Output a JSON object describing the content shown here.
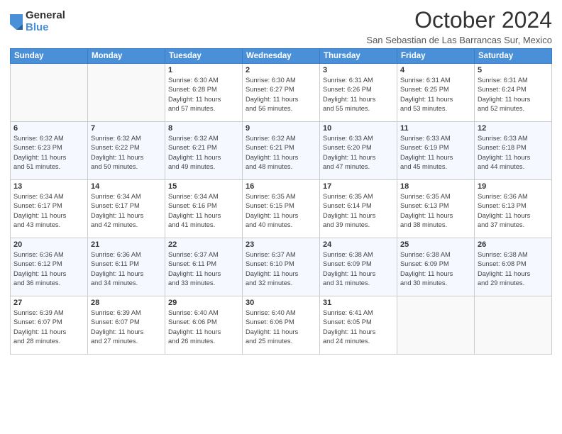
{
  "logo": {
    "general": "General",
    "blue": "Blue"
  },
  "title": "October 2024",
  "location": "San Sebastian de Las Barrancas Sur, Mexico",
  "weekdays": [
    "Sunday",
    "Monday",
    "Tuesday",
    "Wednesday",
    "Thursday",
    "Friday",
    "Saturday"
  ],
  "weeks": [
    [
      {
        "day": "",
        "info": ""
      },
      {
        "day": "",
        "info": ""
      },
      {
        "day": "1",
        "info": "Sunrise: 6:30 AM\nSunset: 6:28 PM\nDaylight: 11 hours\nand 57 minutes."
      },
      {
        "day": "2",
        "info": "Sunrise: 6:30 AM\nSunset: 6:27 PM\nDaylight: 11 hours\nand 56 minutes."
      },
      {
        "day": "3",
        "info": "Sunrise: 6:31 AM\nSunset: 6:26 PM\nDaylight: 11 hours\nand 55 minutes."
      },
      {
        "day": "4",
        "info": "Sunrise: 6:31 AM\nSunset: 6:25 PM\nDaylight: 11 hours\nand 53 minutes."
      },
      {
        "day": "5",
        "info": "Sunrise: 6:31 AM\nSunset: 6:24 PM\nDaylight: 11 hours\nand 52 minutes."
      }
    ],
    [
      {
        "day": "6",
        "info": "Sunrise: 6:32 AM\nSunset: 6:23 PM\nDaylight: 11 hours\nand 51 minutes."
      },
      {
        "day": "7",
        "info": "Sunrise: 6:32 AM\nSunset: 6:22 PM\nDaylight: 11 hours\nand 50 minutes."
      },
      {
        "day": "8",
        "info": "Sunrise: 6:32 AM\nSunset: 6:21 PM\nDaylight: 11 hours\nand 49 minutes."
      },
      {
        "day": "9",
        "info": "Sunrise: 6:32 AM\nSunset: 6:21 PM\nDaylight: 11 hours\nand 48 minutes."
      },
      {
        "day": "10",
        "info": "Sunrise: 6:33 AM\nSunset: 6:20 PM\nDaylight: 11 hours\nand 47 minutes."
      },
      {
        "day": "11",
        "info": "Sunrise: 6:33 AM\nSunset: 6:19 PM\nDaylight: 11 hours\nand 45 minutes."
      },
      {
        "day": "12",
        "info": "Sunrise: 6:33 AM\nSunset: 6:18 PM\nDaylight: 11 hours\nand 44 minutes."
      }
    ],
    [
      {
        "day": "13",
        "info": "Sunrise: 6:34 AM\nSunset: 6:17 PM\nDaylight: 11 hours\nand 43 minutes."
      },
      {
        "day": "14",
        "info": "Sunrise: 6:34 AM\nSunset: 6:17 PM\nDaylight: 11 hours\nand 42 minutes."
      },
      {
        "day": "15",
        "info": "Sunrise: 6:34 AM\nSunset: 6:16 PM\nDaylight: 11 hours\nand 41 minutes."
      },
      {
        "day": "16",
        "info": "Sunrise: 6:35 AM\nSunset: 6:15 PM\nDaylight: 11 hours\nand 40 minutes."
      },
      {
        "day": "17",
        "info": "Sunrise: 6:35 AM\nSunset: 6:14 PM\nDaylight: 11 hours\nand 39 minutes."
      },
      {
        "day": "18",
        "info": "Sunrise: 6:35 AM\nSunset: 6:13 PM\nDaylight: 11 hours\nand 38 minutes."
      },
      {
        "day": "19",
        "info": "Sunrise: 6:36 AM\nSunset: 6:13 PM\nDaylight: 11 hours\nand 37 minutes."
      }
    ],
    [
      {
        "day": "20",
        "info": "Sunrise: 6:36 AM\nSunset: 6:12 PM\nDaylight: 11 hours\nand 36 minutes."
      },
      {
        "day": "21",
        "info": "Sunrise: 6:36 AM\nSunset: 6:11 PM\nDaylight: 11 hours\nand 34 minutes."
      },
      {
        "day": "22",
        "info": "Sunrise: 6:37 AM\nSunset: 6:11 PM\nDaylight: 11 hours\nand 33 minutes."
      },
      {
        "day": "23",
        "info": "Sunrise: 6:37 AM\nSunset: 6:10 PM\nDaylight: 11 hours\nand 32 minutes."
      },
      {
        "day": "24",
        "info": "Sunrise: 6:38 AM\nSunset: 6:09 PM\nDaylight: 11 hours\nand 31 minutes."
      },
      {
        "day": "25",
        "info": "Sunrise: 6:38 AM\nSunset: 6:09 PM\nDaylight: 11 hours\nand 30 minutes."
      },
      {
        "day": "26",
        "info": "Sunrise: 6:38 AM\nSunset: 6:08 PM\nDaylight: 11 hours\nand 29 minutes."
      }
    ],
    [
      {
        "day": "27",
        "info": "Sunrise: 6:39 AM\nSunset: 6:07 PM\nDaylight: 11 hours\nand 28 minutes."
      },
      {
        "day": "28",
        "info": "Sunrise: 6:39 AM\nSunset: 6:07 PM\nDaylight: 11 hours\nand 27 minutes."
      },
      {
        "day": "29",
        "info": "Sunrise: 6:40 AM\nSunset: 6:06 PM\nDaylight: 11 hours\nand 26 minutes."
      },
      {
        "day": "30",
        "info": "Sunrise: 6:40 AM\nSunset: 6:06 PM\nDaylight: 11 hours\nand 25 minutes."
      },
      {
        "day": "31",
        "info": "Sunrise: 6:41 AM\nSunset: 6:05 PM\nDaylight: 11 hours\nand 24 minutes."
      },
      {
        "day": "",
        "info": ""
      },
      {
        "day": "",
        "info": ""
      }
    ]
  ]
}
